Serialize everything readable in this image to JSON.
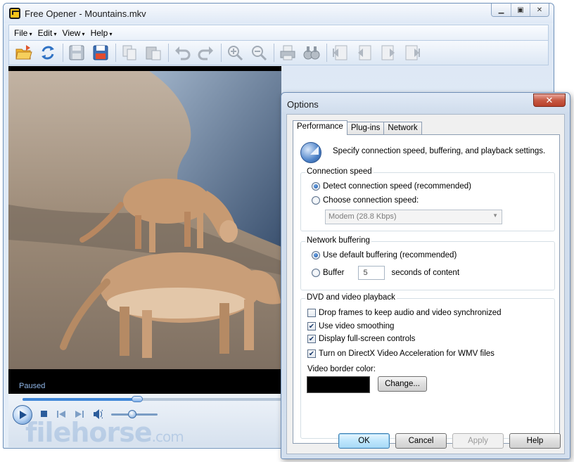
{
  "main_window": {
    "title": "Free Opener - Mountains.mkv",
    "controls": [
      "minimize",
      "maximize",
      "close"
    ],
    "menu": [
      "File",
      "Edit",
      "View",
      "Help"
    ],
    "toolbar": [
      {
        "name": "open-folder-icon",
        "enabled": true
      },
      {
        "name": "refresh-icon",
        "enabled": true
      },
      {
        "name": "save-icon",
        "enabled": false
      },
      {
        "name": "save-as-icon",
        "enabled": true
      },
      {
        "name": "copy-icon",
        "enabled": false
      },
      {
        "name": "paste-icon",
        "enabled": false
      },
      {
        "name": "undo-icon",
        "enabled": false
      },
      {
        "name": "redo-icon",
        "enabled": false
      },
      {
        "name": "zoom-in-icon",
        "enabled": false
      },
      {
        "name": "zoom-out-icon",
        "enabled": false
      },
      {
        "name": "print-icon",
        "enabled": false
      },
      {
        "name": "find-icon",
        "enabled": false
      },
      {
        "name": "first-page-icon",
        "enabled": false
      },
      {
        "name": "previous-page-icon",
        "enabled": false
      },
      {
        "name": "next-page-icon",
        "enabled": false
      },
      {
        "name": "last-page-icon",
        "enabled": false
      }
    ],
    "player": {
      "status": "Paused",
      "seek_position": 0.44,
      "volume": 0.45
    },
    "watermark": {
      "main": "filehorse",
      "suffix": ".com"
    }
  },
  "options_dialog": {
    "title": "Options",
    "close_glyph": "✕",
    "tabs": [
      "Performance",
      "Plug-ins",
      "Network"
    ],
    "active_tab": "Performance",
    "intro": "Specify connection speed, buffering, and playback settings.",
    "connection_speed": {
      "label": "Connection speed",
      "detect": "Detect connection speed (recommended)",
      "choose": "Choose connection speed:",
      "selected": "detect",
      "dropdown_value": "Modem (28.8 Kbps)"
    },
    "network_buffering": {
      "label": "Network buffering",
      "default": "Use default buffering (recommended)",
      "buffer": "Buffer",
      "buffer_value": "5",
      "buffer_suffix": "seconds of content",
      "selected": "default"
    },
    "dvd_playback": {
      "label": "DVD and video playback",
      "options": [
        {
          "label": "Drop frames to keep audio and video synchronized",
          "checked": false
        },
        {
          "label": "Use video smoothing",
          "checked": true
        },
        {
          "label": "Display full-screen controls",
          "checked": true
        },
        {
          "label": "Turn on DirectX Video Acceleration for WMV files",
          "checked": true
        }
      ],
      "border_color_label": "Video border color:",
      "border_color": "#000000",
      "change_button": "Change..."
    },
    "buttons": {
      "ok": "OK",
      "cancel": "Cancel",
      "apply": "Apply",
      "help": "Help"
    }
  },
  "colors": {
    "accent": "#3f86d8",
    "status_text": "#8fb6e8",
    "close_button": "#c75a44"
  }
}
